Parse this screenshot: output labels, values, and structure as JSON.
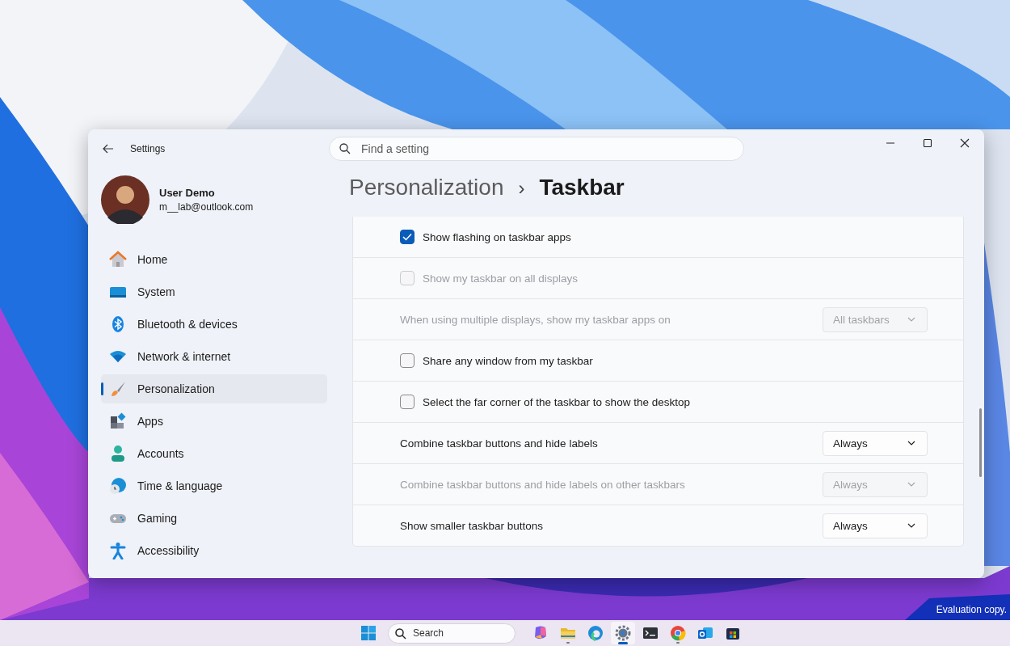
{
  "window": {
    "title": "Settings"
  },
  "search": {
    "placeholder": "Find a setting"
  },
  "user": {
    "name": "User Demo",
    "email": "m__lab@outlook.com"
  },
  "nav": [
    {
      "label": "Home",
      "selected": false
    },
    {
      "label": "System",
      "selected": false
    },
    {
      "label": "Bluetooth & devices",
      "selected": false
    },
    {
      "label": "Network & internet",
      "selected": false
    },
    {
      "label": "Personalization",
      "selected": true
    },
    {
      "label": "Apps",
      "selected": false
    },
    {
      "label": "Accounts",
      "selected": false
    },
    {
      "label": "Time & language",
      "selected": false
    },
    {
      "label": "Gaming",
      "selected": false
    },
    {
      "label": "Accessibility",
      "selected": false
    }
  ],
  "breadcrumb": {
    "parent": "Personalization",
    "separator": "›",
    "current": "Taskbar"
  },
  "settings": [
    {
      "kind": "checkbox",
      "label": "Show flashing on taskbar apps",
      "checked": true,
      "disabled": false
    },
    {
      "kind": "checkbox",
      "label": "Show my taskbar on all displays",
      "checked": false,
      "disabled": true
    },
    {
      "kind": "dropdown",
      "label": "When using multiple displays, show my taskbar apps on",
      "value": "All taskbars",
      "disabled": true
    },
    {
      "kind": "checkbox",
      "label": "Share any window from my taskbar",
      "checked": false,
      "disabled": false
    },
    {
      "kind": "checkbox",
      "label": "Select the far corner of the taskbar to show the desktop",
      "checked": false,
      "disabled": false
    },
    {
      "kind": "dropdown",
      "label": "Combine taskbar buttons and hide labels",
      "value": "Always",
      "disabled": false
    },
    {
      "kind": "dropdown",
      "label": "Combine taskbar buttons and hide labels on other taskbars",
      "value": "Always",
      "disabled": true
    },
    {
      "kind": "dropdown",
      "label": "Show smaller taskbar buttons",
      "value": "Always",
      "disabled": false
    }
  ],
  "taskbar": {
    "search_placeholder": "Search",
    "apps": [
      {
        "running": false,
        "selected": false
      },
      {
        "running": true,
        "selected": false
      },
      {
        "running": false,
        "selected": false
      },
      {
        "running": true,
        "selected": true
      },
      {
        "running": false,
        "selected": false
      },
      {
        "running": true,
        "selected": false
      },
      {
        "running": false,
        "selected": false
      },
      {
        "running": false,
        "selected": false
      }
    ]
  },
  "desktop_text": "Evaluation copy."
}
